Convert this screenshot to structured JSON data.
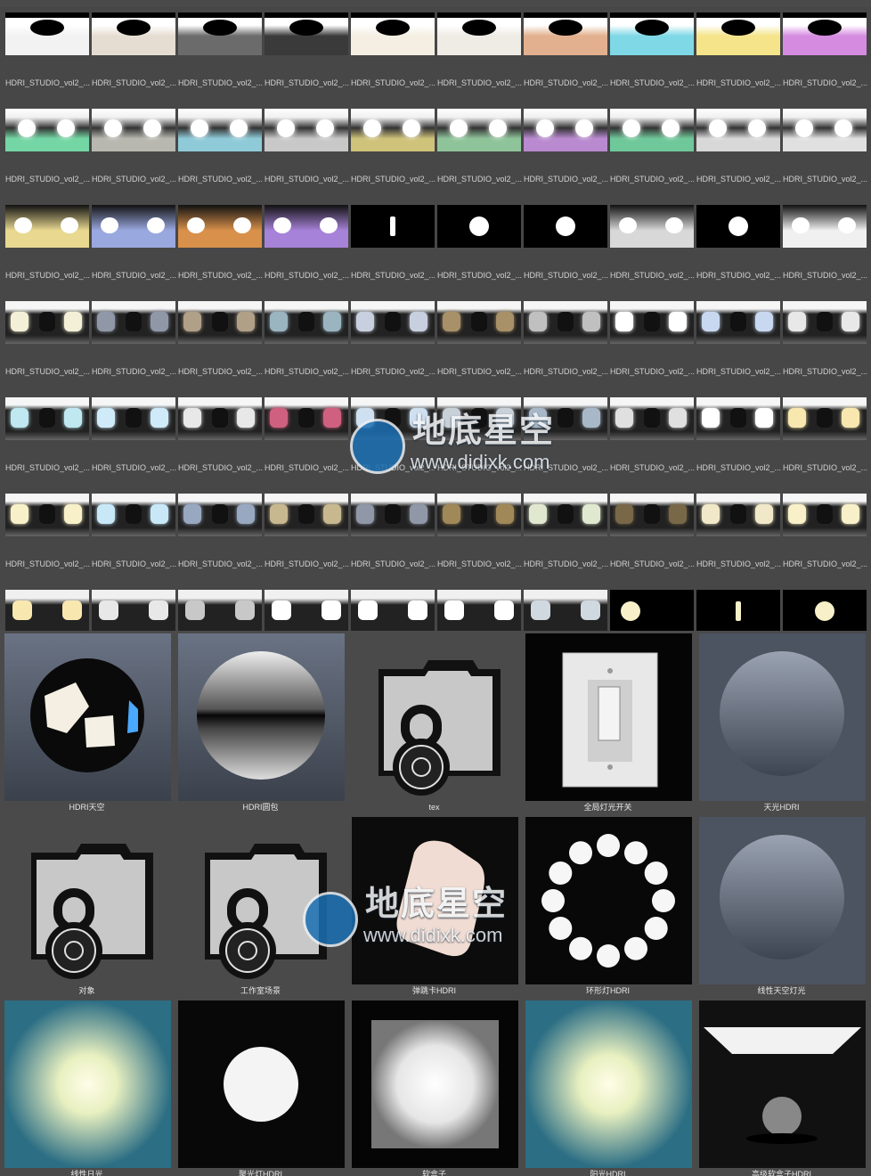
{
  "hdri_grid": {
    "rows": [
      {
        "labels": [
          "HDRI_STUDIO_vol2_...",
          "HDRI_STUDIO_vol2_...",
          "HDRI_STUDIO_vol2_...",
          "HDRI_STUDIO_vol2_...",
          "HDRI_STUDIO_vol2_...",
          "HDRI_STUDIO_vol2_...",
          "HDRI_STUDIO_vol2_...",
          "HDRI_STUDIO_vol2_...",
          "HDRI_STUDIO_vol2_...",
          "HDRI_STUDIO_vol2_..."
        ],
        "colors": [
          "#f2f2f2",
          "#e6ddd2",
          "#6b6b6b",
          "#3a3a3a",
          "#f4efe2",
          "#efece6",
          "#e2b08e",
          "#7fd8e6",
          "#f5e48a",
          "#d58be0"
        ],
        "style": "dome"
      },
      {
        "labels": [
          "HDRI_STUDIO_vol2_...",
          "HDRI_STUDIO_vol2_...",
          "HDRI_STUDIO_vol2_...",
          "HDRI_STUDIO_vol2_...",
          "HDRI_STUDIO_vol2_...",
          "HDRI_STUDIO_vol2_...",
          "HDRI_STUDIO_vol2_...",
          "HDRI_STUDIO_vol2_...",
          "HDRI_STUDIO_vol2_...",
          "HDRI_STUDIO_vol2_..."
        ],
        "colors": [
          "#74d6a4",
          "#b8b8b0",
          "#8fcad8",
          "#c8c8c8",
          "#cfc27a",
          "#8fc49a",
          "#b98ad0",
          "#6fc89a",
          "#d8d8d8",
          "#e0e0e0"
        ],
        "style": "twin"
      },
      {
        "labels": [
          "HDRI_STUDIO_vol2_...",
          "HDRI_STUDIO_vol2_...",
          "HDRI_STUDIO_vol2_...",
          "HDRI_STUDIO_vol2_...",
          "HDRI_STUDIO_vol2_...",
          "HDRI_STUDIO_vol2_...",
          "HDRI_STUDIO_vol2_...",
          "HDRI_STUDIO_vol2_...",
          "HDRI_STUDIO_vol2_...",
          "HDRI_STUDIO_vol2_..."
        ],
        "colors": [
          "#e8d890",
          "#9aa8e0",
          "#d8904a",
          "#a682d8",
          "#000000",
          "#000000",
          "#000000",
          "#d8d8d8",
          "#000000",
          "#f0f0f0"
        ],
        "style": "mixed"
      },
      {
        "labels": [
          "HDRI_STUDIO_vol2_...",
          "HDRI_STUDIO_vol2_...",
          "HDRI_STUDIO_vol2_...",
          "HDRI_STUDIO_vol2_...",
          "HDRI_STUDIO_vol2_...",
          "HDRI_STUDIO_vol2_...",
          "HDRI_STUDIO_vol2_...",
          "HDRI_STUDIO_vol2_...",
          "HDRI_STUDIO_vol2_...",
          "HDRI_STUDIO_vol2_..."
        ],
        "colors": [
          "#f4f0d8",
          "#9098a8",
          "#b0a088",
          "#9ab4c0",
          "#c8d0e0",
          "#a89068",
          "#c0c0c0",
          "#ffffff",
          "#c8d8f0",
          "#e8e8e8"
        ],
        "style": "panels"
      },
      {
        "labels": [
          "HDRI_STUDIO_vol2_...",
          "HDRI_STUDIO_vol2_...",
          "HDRI_STUDIO_vol2_...",
          "HDRI_STUDIO_vol2_...",
          "HDRI_STUDIO_vol2_...",
          "HDRI_STUDIO_vol2_...",
          "HDRI_STUDIO_vol2_...",
          "HDRI_STUDIO_vol2_...",
          "HDRI_STUDIO_vol2_...",
          "HDRI_STUDIO_vol2_..."
        ],
        "colors": [
          "#bfe8f0",
          "#cfeaf8",
          "#e8e8e8",
          "#d06080",
          "#cfe0f0",
          "#c8d0d8",
          "#a8b8c8",
          "#e0e0e0",
          "#ffffff",
          "#f8e8b0"
        ],
        "style": "panels"
      },
      {
        "labels": [
          "HDRI_STUDIO_vol2_...",
          "HDRI_STUDIO_vol2_...",
          "HDRI_STUDIO_vol2_...",
          "HDRI_STUDIO_vol2_...",
          "HDRI_STUDIO_vol2_...",
          "HDRI_STUDIO_vol2_...",
          "HDRI_STUDIO_vol2_...",
          "HDRI_STUDIO_vol2_...",
          "HDRI_STUDIO_vol2_...",
          "HDRI_STUDIO_vol2_..."
        ],
        "colors": [
          "#f8f0c8",
          "#c8e8f8",
          "#98a8c0",
          "#c8b890",
          "#9098a8",
          "#a08858",
          "#e0e8d0",
          "#786848",
          "#f0e8c8",
          "#f8f0c8"
        ],
        "style": "panels"
      },
      {
        "labels": [],
        "colors": [
          "#f8e8b0",
          "#e8e8e8",
          "#c8c8c8",
          "#ffffff",
          "#ffffff",
          "#ffffff",
          "#d0d8e0",
          "#000000",
          "#000000",
          "#000000"
        ],
        "style": "partial"
      }
    ]
  },
  "presets": {
    "rows": [
      {
        "items": [
          {
            "label": "HDRI天空",
            "kind": "sphere-dark"
          },
          {
            "label": "HDRI圆包",
            "kind": "sphere-chrome"
          },
          {
            "label": "tex",
            "kind": "lock-folder"
          },
          {
            "label": "全局灯光开关",
            "kind": "switch"
          },
          {
            "label": "天光HDRI",
            "kind": "sphere-grey"
          }
        ]
      },
      {
        "items": [
          {
            "label": "对象",
            "kind": "lock-folder"
          },
          {
            "label": "工作室场景",
            "kind": "lock-folder"
          },
          {
            "label": "弹跳卡HDRI",
            "kind": "card"
          },
          {
            "label": "环形灯HDRI",
            "kind": "ring"
          },
          {
            "label": "线性天空灯光",
            "kind": "sphere-grey"
          }
        ]
      },
      {
        "items": [
          {
            "label": "线性日光",
            "kind": "sun"
          },
          {
            "label": "聚光灯HDRI",
            "kind": "spot"
          },
          {
            "label": "软盒子",
            "kind": "softbox"
          },
          {
            "label": "阳光HDRI",
            "kind": "sun"
          },
          {
            "label": "高级软盒子HDRI",
            "kind": "advanced-softbox"
          }
        ]
      }
    ]
  },
  "watermarks": [
    {
      "cn": "地底星空",
      "url": "www.didixk.com"
    },
    {
      "cn": "地底星空",
      "url": "www.didixk.com"
    }
  ]
}
